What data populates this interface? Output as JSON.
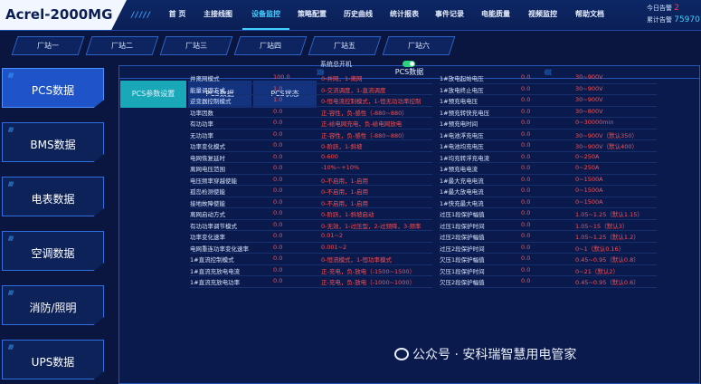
{
  "app": {
    "title": "Acrel-2000MG",
    "decor": "/////"
  },
  "nav": {
    "items": [
      "首 页",
      "主接线图",
      "设备监控",
      "策略配置",
      "历史曲线",
      "统计报表",
      "事件记录",
      "电能质量",
      "视频监控",
      "帮助文档"
    ],
    "active_index": 2
  },
  "alarm": {
    "today_label": "今日告警",
    "today_value": "2",
    "total_label": "累计告警",
    "total_value": "75970"
  },
  "stations": [
    "厂站一",
    "厂站二",
    "厂站三",
    "厂站四",
    "厂站五",
    "厂站六"
  ],
  "menu": {
    "items": [
      "PCS数据",
      "BMS数据",
      "电表数据",
      "空调数据",
      "消防/照明",
      "UPS数据"
    ],
    "active_index": 0,
    "decor": "/////"
  },
  "panel": {
    "title": "PCS数据",
    "decor_left": "》》》",
    "decor_right": "《《《",
    "subtabs": [
      "PCS参数设置",
      "PCS数据",
      "PCS状态"
    ],
    "active_subtab": 0
  },
  "system_switch": {
    "label": "系统总开机",
    "on": true
  },
  "left_params": [
    {
      "label": "并离网模式",
      "value": "100.0",
      "range": "0-并网，1-离网"
    },
    {
      "label": "能量调度方式",
      "value": "1.0",
      "range": "0-交流调度，1-直流调度"
    },
    {
      "label": "逆变器控制模式",
      "value": "1.0",
      "range": "0-恒电流控制模式，1-恒无功功率控制"
    },
    {
      "label": "功率因数",
      "value": "0.0",
      "range": "正-容性，负-感性（-880~880）"
    },
    {
      "label": "有功功率",
      "value": "0.0",
      "range": "正-给电网充电，负-给电网放电"
    },
    {
      "label": "无功功率",
      "value": "0.0",
      "range": "正-容性，负-感性（-880~880）"
    },
    {
      "label": "功率变化模式",
      "value": "0.0",
      "range": "0-阶跃，1-斜坡"
    },
    {
      "label": "电网恢复延时",
      "value": "0.0",
      "range": "0-600"
    },
    {
      "label": "离网电压范围",
      "value": "0.0",
      "range": "-10%~+10%"
    },
    {
      "label": "电压频率穿越使能",
      "value": "0.0",
      "range": "0-不启用，1-启用"
    },
    {
      "label": "孤岛检测使能",
      "value": "0.0",
      "range": "0-不启用，1-启用"
    },
    {
      "label": "接地故障使能",
      "value": "0.0",
      "range": "0-不启用，1-启用"
    },
    {
      "label": "离网启动方式",
      "value": "0.0",
      "range": "0-阶跃，1-斜坡启动"
    },
    {
      "label": "有功功率调节模式",
      "value": "0.0",
      "range": "0-无效，1-过压型，2-过频降，3-频率"
    },
    {
      "label": "功率变化速率",
      "value": "0.0",
      "range": "0.01~2"
    },
    {
      "label": "电网重连功率变化速率",
      "value": "0.0",
      "range": "0.001~2"
    },
    {
      "label": "1#直流控制模式",
      "value": "0.0",
      "range": "0-恒流模式，1-恒功率模式"
    },
    {
      "label": "1#直流充放电电流",
      "value": "0.0",
      "range": "正-充电，负-放电（-1500~1500）"
    },
    {
      "label": "1#直流充放电功率",
      "value": "0.0",
      "range": "正-充电，负-放电（-1000~1000）"
    }
  ],
  "right_params": [
    {
      "label": "1#放电起始电压",
      "value": "0.0",
      "range": "30~900V"
    },
    {
      "label": "1#放电终止电压",
      "value": "0.0",
      "range": "30~900V"
    },
    {
      "label": "1#预充电电压",
      "value": "0.0",
      "range": "30~900V"
    },
    {
      "label": "1#预充转快充电压",
      "value": "0.0",
      "range": "30~800V"
    },
    {
      "label": "1#预充电时间",
      "value": "0.0",
      "range": "0~30000min"
    },
    {
      "label": "1#电池浮充电压",
      "value": "0.0",
      "range": "30~900V（默认350）"
    },
    {
      "label": "1#电池均充电压",
      "value": "0.0",
      "range": "30~900V（默认400）"
    },
    {
      "label": "1#均充转浮充电流",
      "value": "0.0",
      "range": "0~250A"
    },
    {
      "label": "1#预充电电流",
      "value": "0.0",
      "range": "0~250A"
    },
    {
      "label": "1#最大充电电流",
      "value": "0.0",
      "range": "0~1500A"
    },
    {
      "label": "1#最大放电电流",
      "value": "0.0",
      "range": "0~1500A"
    },
    {
      "label": "1#快充最大电流",
      "value": "0.0",
      "range": "0~1500A"
    },
    {
      "label": "过压1段保护幅值",
      "value": "0.0",
      "range": "1.05~1.25（默认1.15）"
    },
    {
      "label": "过压1段保护时间",
      "value": "0.0",
      "range": "1.05~15（默认3）"
    },
    {
      "label": "过压2段保护幅值",
      "value": "0.0",
      "range": "1.05~1.25（默认1.2）"
    },
    {
      "label": "过压2段保护时间",
      "value": "0.0",
      "range": "0~1（默认0.16）"
    },
    {
      "label": "欠压1段保护幅值",
      "value": "0.0",
      "range": "0.45~0.95（默认0.8）"
    },
    {
      "label": "欠压1段保护时间",
      "value": "0.0",
      "range": "0~21（默认2）"
    },
    {
      "label": "欠压2段保护幅值",
      "value": "0.0",
      "range": "0.45~0.95（默认0.6）"
    }
  ],
  "watermark": {
    "text": "公众号 · 安科瑞智慧用电管家"
  }
}
